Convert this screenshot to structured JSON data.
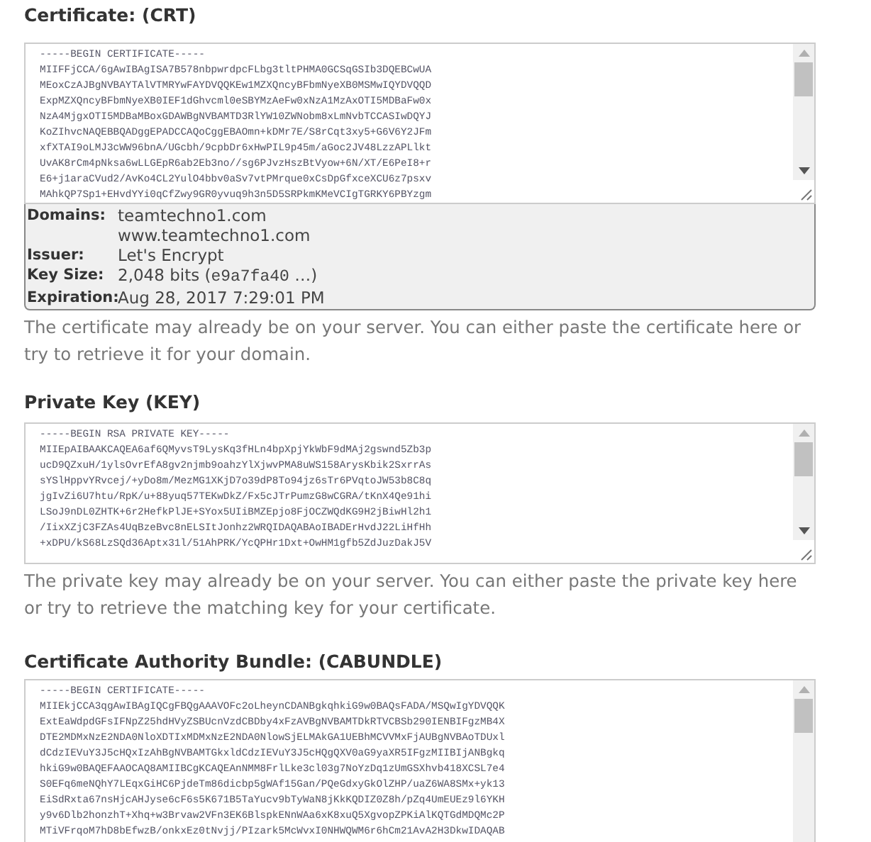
{
  "sections": [
    {
      "label": "Certificate: (CRT)",
      "field_lines": [
        "-----BEGIN CERTIFICATE-----",
        "MIIFFjCCA/6gAwIBAgISA7B578nbpwrdpcFLbg3tltPHMA0GCSqGSIb3DQEBCwUA",
        "MEoxCzAJBgNVBAYTAlVTMRYwFAYDVQQKEw1MZXQncyBFbmNyeXB0MSMwIQYDVQQD",
        "ExpMZXQncyBFbmNyeXB0IEF1dGhvcml0eSBYMzAeFw0xNzA1MzAxOTI5MDBaFw0x",
        "NzA4MjgxOTI5MDBaMBoxGDAWBgNVBAMTD3RlYW10ZWNobm8xLmNvbTCCASIwDQYJ",
        "KoZIhvcNAQEBBQADggEPADCCAQoCggEBAOmn+kDMr7E/S8rCqt3xy5+G6V6Y2JFm",
        "xfXTAI9oLMJ3cWW96bnA/UGcbh/9cpbDr6xHwPIL9p45m/aGoc2JV48LzzAPLlkt",
        "UvAK8rCm4pNksa6wLLGEpR6ab2Eb3no//sg6PJvzHszBtVyow+6N/XT/E6PeI8+r",
        "E6+j1araCVud2/AvKo4CL2YulO4bbv0aSv7vtPMrque0xCsDpGfxceXCU6z7psxv",
        "MAhkQP7Sp1+EHvdYYi0qCfZwy9GR0yvuq9h3n5D5SRPkmKMeVCIgTGRKY6PBYzgm"
      ],
      "details": [
        {
          "kind": "text",
          "label": "Domains:",
          "values": [
            "teamtechno1.com",
            "www.teamtechno1.com"
          ]
        },
        {
          "kind": "text",
          "label": "Issuer:",
          "values": [
            "Let's Encrypt"
          ]
        },
        {
          "kind": "key",
          "label": "Key Size:",
          "prefix": "2,048 bits (",
          "key_id": "e9a7fa40",
          "suffix": " …)"
        },
        {
          "kind": "text",
          "label": "Expiration:",
          "values": [
            "Aug 28, 2017 7:29:01 PM"
          ]
        }
      ],
      "help": "The certificate may already be on your server. You can either paste the certificate here or try to retrieve it for your domain."
    },
    {
      "label": "Private Key (KEY)",
      "field_lines": [
        "-----BEGIN RSA PRIVATE KEY-----",
        "MIIEpAIBAAKCAQEA6af6QMyvsT9LysKq3fHLn4bpXpjYkWbF9dMAj2gswnd5Zb3p",
        "ucD9QZxuH/1ylsOvrEfA8gv2njmb9oahzYlXjwvPMA8uWS158ArysKbik2SxrrAs",
        "sYSlHppvYRvcej/+yDo8m/MezMG1XKjD7o39dP8To94jz6sTr6PVqtoJW53b8C8q",
        "jgIvZi6U7htu/RpK/u+88yuq57TEKwDkZ/Fx5cJTrPumzG8wCGRA/tKnX4Qe91hi",
        "LSoJ9nDL0ZHTK+6r2HefkPlJE+SYox5UIiBMZEpjo8FjOCZWQdKG9H2jBiwHl2h1",
        "/IixXZjC3FZAs4UqBzeBvc8nELSItJonhz2WRQIDAQABAoIBADErHvdJ22LiHfHh",
        "+xDPU/kS68LzSQd36Aptx31l/51AhPRK/YcQPHr1Dxt+OwHM1gfb5ZdJuzDakJ5V"
      ],
      "help": "The private key may already be on your server. You can either paste the private key here or try to retrieve the matching key for your certificate."
    },
    {
      "label": "Certificate Authority Bundle: (CABUNDLE)",
      "field_lines": [
        "-----BEGIN CERTIFICATE-----",
        "MIIEkjCCA3qgAwIBAgIQCgFBQgAAAVOFc2oLheynCDANBgkqhkiG9w0BAQsFADA/MSQwIgYDVQQK",
        "ExtEaWdpdGFsIFNpZ25hdHVyZSBUcnVzdCBDby4xFzAVBgNVBAMTDkRTVCBSb290IENBIFgzMB4X",
        "DTE2MDMxNzE2NDA0NloXDTIxMDMxNzE2NDA0NlowSjELMAkGA1UEBhMCVVMxFjAUBgNVBAoTDUxl",
        "dCdzIEVuY3J5cHQxIzAhBgNVBAMTGkxldCdzIEVuY3J5cHQgQXV0aG9yaXR5IFgzMIIBIjANBgkq",
        "hkiG9w0BAQEFAAOCAQ8AMIIBCgKCAQEAnNMM8FrlLke3cl03g7NoYzDq1zUmGSXhvb418XCSL7e4",
        "S0EFq6meNQhY7LEqxGiHC6PjdeTm86dicbp5gWAf15Gan/PQeGdxyGkOlZHP/uaZ6WA8SMx+yk13",
        "EiSdRxta67nsHjcAHJyse6cF6s5K671B5TaYucv9bTyWaN8jKkKQDIZ0Z8h/pZq4UmEUEz9l6YKH",
        "y9v6Dlb2honzhT+Xhq+w3Brvaw2VFn3EK6BlspkENnWAa6xK8xuQ5XgvopZPKiAlKQTGdMDQMc2P",
        "MTiVFrqoM7hD8bEfwzB/onkxEz0tNvjj/PIzark5McWvxI0NHWQWM6r6hCm21AvA2H3DkwIDAQAB"
      ]
    }
  ]
}
